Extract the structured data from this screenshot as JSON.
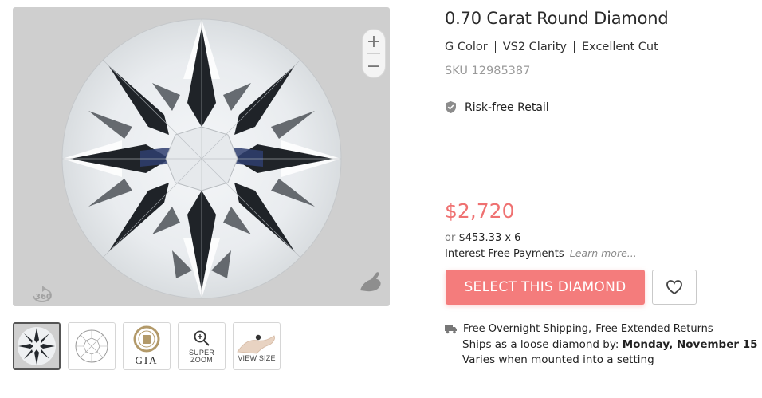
{
  "product": {
    "title": "0.70 Carat Round Diamond",
    "color": "G Color",
    "clarity": "VS2 Clarity",
    "cut": "Excellent Cut",
    "sku": "SKU 12985387",
    "risk_free_label": "Risk-free Retail"
  },
  "viewer": {
    "zoom_in": "+",
    "zoom_out": "−",
    "rotate_icon": "360-rotate-icon",
    "hand_icon": "hand-icon"
  },
  "thumbnails": [
    {
      "name": "diamond-photo",
      "label": ""
    },
    {
      "name": "diamond-diagram",
      "label": ""
    },
    {
      "name": "gia-certificate",
      "label": "GIA"
    },
    {
      "name": "super-zoom",
      "label_line1": "SUPER",
      "label_line2": "ZOOM"
    },
    {
      "name": "view-size",
      "label": "VIEW SIZE"
    }
  ],
  "pricing": {
    "price": "$2,720",
    "or_label": "or",
    "installment": "$453.33 x 6",
    "interest_label": "Interest Free Payments",
    "learn_more": "Learn more..."
  },
  "actions": {
    "select_label": "SELECT THIS DIAMOND",
    "favorite_icon": "heart-icon"
  },
  "shipping": {
    "overnight": "Free Overnight Shipping",
    "comma": ",",
    "returns": "Free Extended Returns",
    "ships_prefix": "Ships as a loose diamond by:",
    "ships_date": "Monday, November 15",
    "varies": "Varies when mounted into a setting"
  },
  "colors": {
    "accent": "#f47c7c",
    "price": "#ef7171",
    "viewer_bg": "#cfcfcf"
  }
}
